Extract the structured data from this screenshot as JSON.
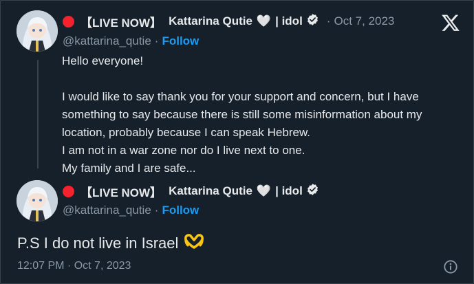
{
  "tweet": {
    "live_prefix": "【LIVE NOW】",
    "name": "Kattarina Qutie",
    "heart_emoji": "🤍",
    "name_suffix": "| idol",
    "date_sep": "·",
    "date": "Oct 7, 2023",
    "handle": "@kattarina_qutie",
    "dot": "·",
    "follow_label": "Follow",
    "text": "Hello everyone!\n\nI would like to say thank you for your support and concern, but I have something to say because there is still some misinformation about my location, probably because I can speak Hebrew.\n I am not in a war zone nor do I live next to one.\nMy family and I are safe..."
  },
  "reply": {
    "live_prefix": "【LIVE NOW】",
    "name": "Kattarina Qutie",
    "heart_emoji": "🤍",
    "name_suffix": "| idol",
    "handle": "@kattarina_qutie",
    "dot": "·",
    "follow_label": "Follow",
    "text": "P.S I do not live in Israel",
    "timestamp": "12:07 PM · Oct 7, 2023"
  },
  "icons": {
    "logo": "x-logo-icon",
    "verified": "verified-badge-icon",
    "info": "info-icon",
    "live": "red-circle-icon",
    "heart_hands": "heart-hands-icon"
  },
  "colors": {
    "background": "#15202b",
    "text": "#e7e9ea",
    "muted": "#8b98a5",
    "accent": "#1d9bf0",
    "live_red": "#f4212e",
    "heart_hands_yellow": "#f9c513"
  }
}
